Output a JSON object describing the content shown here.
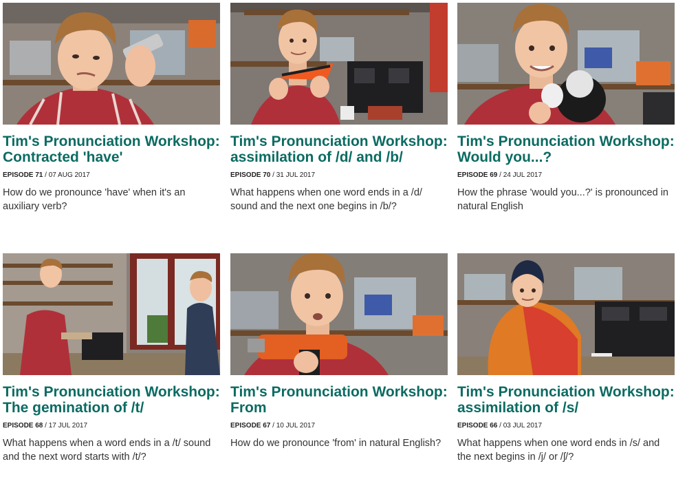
{
  "episodes": [
    {
      "title": "Tim's Pronunciation Workshop: Contracted 'have'",
      "episode": "EPISODE 71",
      "date": "/ 07 AUG 2017",
      "description": "How do we pronounce 'have' when it's an auxiliary verb?",
      "thumbnail_icon": "man-holding-phone-icon"
    },
    {
      "title": "Tim's Pronunciation Workshop: assimilation of /d/ and /b/",
      "episode": "EPISODE 70",
      "date": "/ 31 JUL 2017",
      "description": "What happens when one word ends in a /d/ sound and the next one begins in /b/?",
      "thumbnail_icon": "man-holding-toy-boat-icon"
    },
    {
      "title": "Tim's Pronunciation Workshop: Would you...?",
      "episode": "EPISODE 69",
      "date": "/ 24 JUL 2017",
      "description": "How the phrase 'would you...?' is pronounced in natural English",
      "thumbnail_icon": "man-holding-toy-sheep-icon"
    },
    {
      "title": "Tim's Pronunciation Workshop: The gemination of /t/",
      "episode": "EPISODE 68",
      "date": "/ 17 JUL 2017",
      "description": "What happens when a word ends in a /t/ sound and the next word starts with /t/?",
      "thumbnail_icon": "two-men-in-workshop-icon"
    },
    {
      "title": "Tim's Pronunciation Workshop: From",
      "episode": "EPISODE 67",
      "date": "/ 10 JUL 2017",
      "description": "How do we pronounce 'from' in natural English?",
      "thumbnail_icon": "man-holding-drill-icon"
    },
    {
      "title": "Tim's Pronunciation Workshop: assimilation of /s/",
      "episode": "EPISODE 66",
      "date": "/ 03 JUL 2017",
      "description": "What happens when one word ends in /s/ and the next begins in /j/ or /ʃ/?",
      "thumbnail_icon": "man-wrapped-in-blanket-icon"
    }
  ],
  "colors": {
    "title": "#0b6b62",
    "shirt_red": "#b0303a",
    "hair": "#b07a3a",
    "skin": "#f1c4a4"
  }
}
